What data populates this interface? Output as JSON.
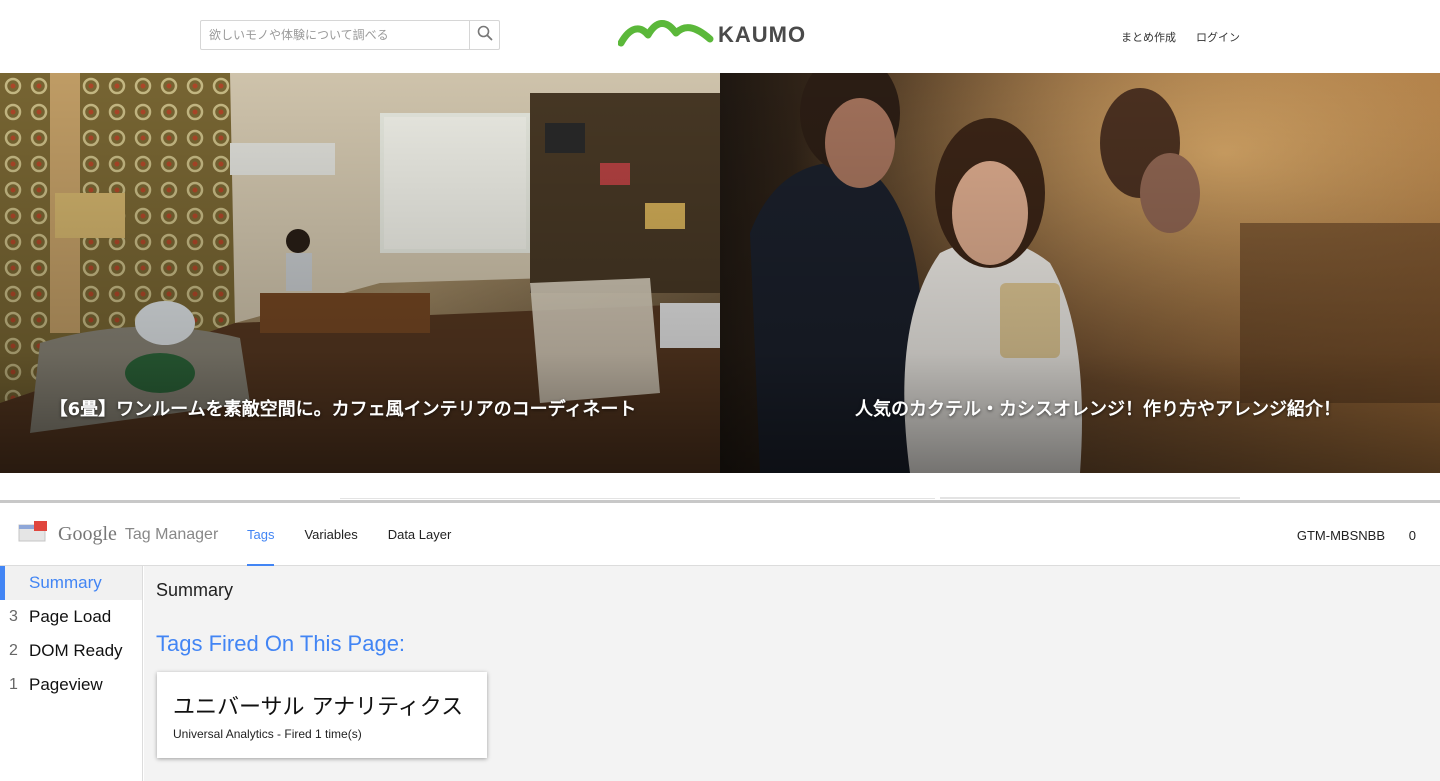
{
  "site": {
    "search": {
      "placeholder": "欲しいモノや体験について調べる",
      "value": ""
    },
    "logo": {
      "text": "KAUMO",
      "color": "#5bb83a"
    },
    "header_links": [
      {
        "label": "まとめ作成"
      },
      {
        "label": "ログイン"
      }
    ],
    "hero": [
      {
        "title": "【6畳】ワンルームを素敵空間に。カフェ風インテリアのコーディネート"
      },
      {
        "title": "人気のカクテル・カシスオレンジ！作り方やアレンジ紹介！"
      }
    ]
  },
  "gtm": {
    "logo_google": "Google",
    "logo_product": "Tag Manager",
    "tabs": [
      {
        "label": "Tags",
        "active": true
      },
      {
        "label": "Variables",
        "active": false
      },
      {
        "label": "Data Layer",
        "active": false
      }
    ],
    "container_id": "GTM-MBSNBB",
    "count": "0",
    "sidebar": [
      {
        "num": "",
        "label": "Summary",
        "active": true
      },
      {
        "num": "3",
        "label": "Page Load",
        "active": false
      },
      {
        "num": "2",
        "label": "DOM Ready",
        "active": false
      },
      {
        "num": "1",
        "label": "Pageview",
        "active": false
      }
    ],
    "main": {
      "heading": "Summary",
      "fired_heading": "Tags Fired On This Page:",
      "tags": [
        {
          "name": "ユニバーサル アナリティクス",
          "status": "Universal Analytics - Fired 1 time(s)"
        }
      ]
    },
    "accent_color": "#4285f4"
  }
}
